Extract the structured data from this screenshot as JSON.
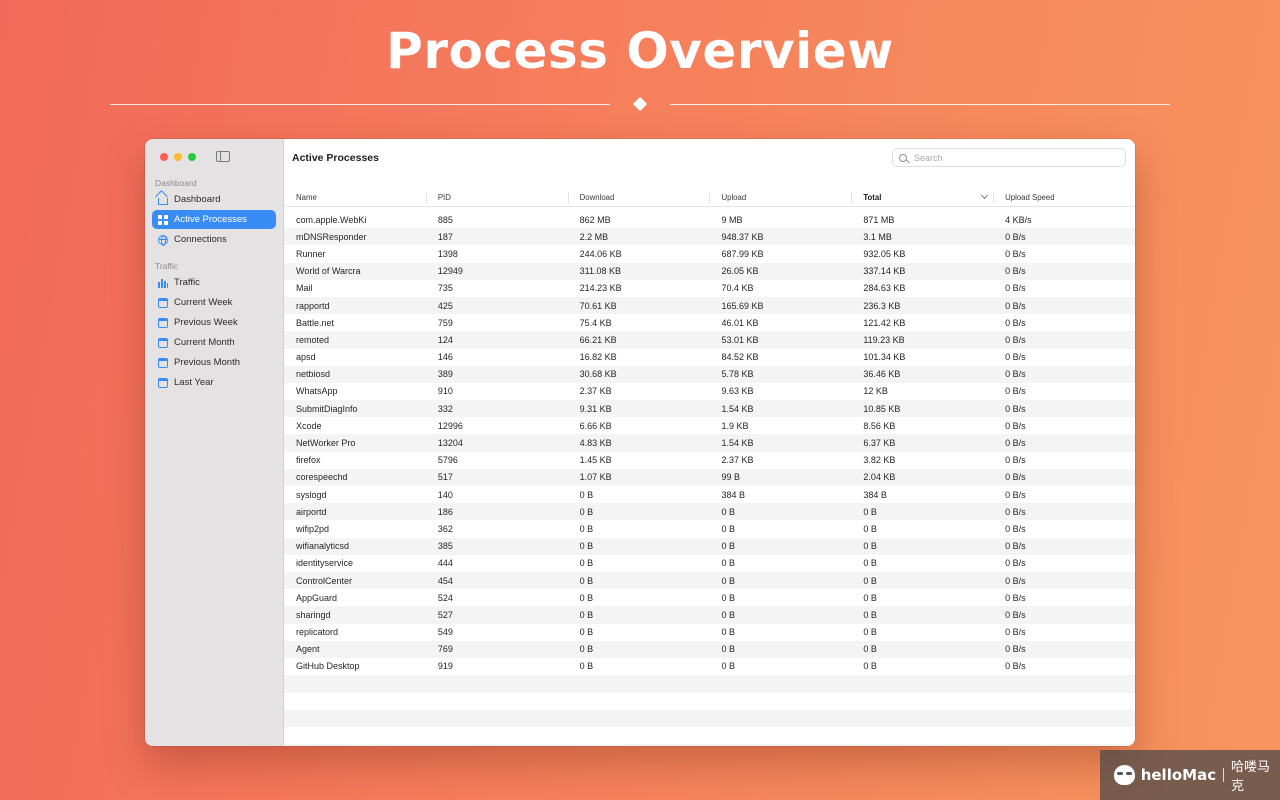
{
  "hero": {
    "title": "Process Overview"
  },
  "sidebar": {
    "sections": [
      {
        "label": "Dashboard",
        "items": [
          {
            "label": "Dashboard",
            "icon": "house-icon"
          },
          {
            "label": "Active Processes",
            "icon": "grid-icon",
            "active": true
          },
          {
            "label": "Connections",
            "icon": "globe-icon"
          }
        ]
      },
      {
        "label": "Traffic",
        "items": [
          {
            "label": "Traffic",
            "icon": "bar-chart-icon"
          },
          {
            "label": "Current Week",
            "icon": "calendar-icon"
          },
          {
            "label": "Previous Week",
            "icon": "calendar-icon"
          },
          {
            "label": "Current Month",
            "icon": "calendar-icon"
          },
          {
            "label": "Previous Month",
            "icon": "calendar-icon"
          },
          {
            "label": "Last Year",
            "icon": "calendar-icon"
          }
        ]
      }
    ]
  },
  "main": {
    "title": "Active Processes",
    "search": {
      "placeholder": "Search",
      "value": ""
    },
    "columns": [
      "Name",
      "PID",
      "Download",
      "Upload",
      "Total",
      "Upload Speed"
    ],
    "sorted_column": "Total",
    "rows": [
      [
        "com.apple.WebKi",
        "885",
        "862 MB",
        "9 MB",
        "871 MB",
        "4 KB/s"
      ],
      [
        "mDNSResponder",
        "187",
        "2.2 MB",
        "948.37 KB",
        "3.1 MB",
        "0 B/s"
      ],
      [
        "Runner",
        "1398",
        "244.06 KB",
        "687.99 KB",
        "932.05 KB",
        "0 B/s"
      ],
      [
        "World of Warcra",
        "12949",
        "311.08 KB",
        "26.05 KB",
        "337.14 KB",
        "0 B/s"
      ],
      [
        "Mail",
        "735",
        "214.23 KB",
        "70.4 KB",
        "284.63 KB",
        "0 B/s"
      ],
      [
        "rapportd",
        "425",
        "70.61 KB",
        "165.69 KB",
        "236.3 KB",
        "0 B/s"
      ],
      [
        "Battle.net",
        "759",
        "75.4 KB",
        "46.01 KB",
        "121.42 KB",
        "0 B/s"
      ],
      [
        "remoted",
        "124",
        "66.21 KB",
        "53.01 KB",
        "119.23 KB",
        "0 B/s"
      ],
      [
        "apsd",
        "146",
        "16.82 KB",
        "84.52 KB",
        "101.34 KB",
        "0 B/s"
      ],
      [
        "netbiosd",
        "389",
        "30.68 KB",
        "5.78 KB",
        "36.46 KB",
        "0 B/s"
      ],
      [
        "WhatsApp",
        "910",
        "2.37 KB",
        "9.63 KB",
        "12 KB",
        "0 B/s"
      ],
      [
        "SubmitDiagInfo",
        "332",
        "9.31 KB",
        "1.54 KB",
        "10.85 KB",
        "0 B/s"
      ],
      [
        "Xcode",
        "12996",
        "6.66 KB",
        "1.9 KB",
        "8.56 KB",
        "0 B/s"
      ],
      [
        "NetWorker Pro",
        "13204",
        "4.83 KB",
        "1.54 KB",
        "6.37 KB",
        "0 B/s"
      ],
      [
        "firefox",
        "5796",
        "1.45 KB",
        "2.37 KB",
        "3.82 KB",
        "0 B/s"
      ],
      [
        "corespeechd",
        "517",
        "1.07 KB",
        "99 B",
        "2.04 KB",
        "0 B/s"
      ],
      [
        "syslogd",
        "140",
        "0 B",
        "384 B",
        "384 B",
        "0 B/s"
      ],
      [
        "airportd",
        "186",
        "0 B",
        "0 B",
        "0 B",
        "0 B/s"
      ],
      [
        "wifip2pd",
        "362",
        "0 B",
        "0 B",
        "0 B",
        "0 B/s"
      ],
      [
        "wifianalyticsd",
        "385",
        "0 B",
        "0 B",
        "0 B",
        "0 B/s"
      ],
      [
        "identityservice",
        "444",
        "0 B",
        "0 B",
        "0 B",
        "0 B/s"
      ],
      [
        "ControlCenter",
        "454",
        "0 B",
        "0 B",
        "0 B",
        "0 B/s"
      ],
      [
        "AppGuard",
        "524",
        "0 B",
        "0 B",
        "0 B",
        "0 B/s"
      ],
      [
        "sharingd",
        "527",
        "0 B",
        "0 B",
        "0 B",
        "0 B/s"
      ],
      [
        "replicatord",
        "549",
        "0 B",
        "0 B",
        "0 B",
        "0 B/s"
      ],
      [
        "Agent",
        "769",
        "0 B",
        "0 B",
        "0 B",
        "0 B/s"
      ],
      [
        "GitHub Desktop",
        "919",
        "0 B",
        "0 B",
        "0 B",
        "0 B/s"
      ]
    ]
  },
  "watermark": {
    "brand": "helloMac",
    "cn": "哈喽马克"
  },
  "colors": {
    "accent": "#3a8cf5",
    "background_start": "#f1695a",
    "background_end": "#f8955d"
  }
}
